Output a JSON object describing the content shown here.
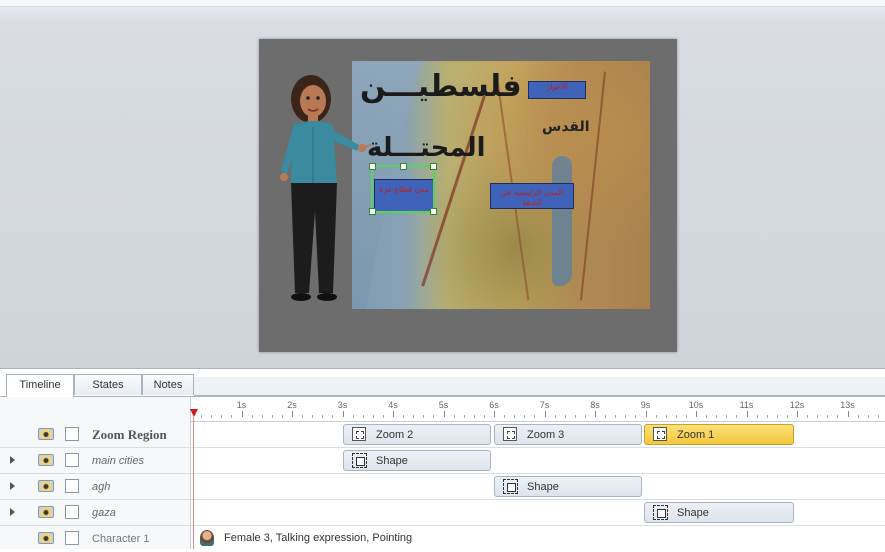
{
  "stage": {
    "map": {
      "title_line1": "فلسطيـــن",
      "title_line2": "المحتـــلة",
      "city_label": "القدس",
      "callout_top": "الاغوار",
      "callout_right": "المدن الرئيسية في الضفة",
      "callout_selected": "مدن قطاع غزة"
    }
  },
  "tabs": [
    {
      "label": "Timeline"
    },
    {
      "label": "States"
    },
    {
      "label": "Notes"
    }
  ],
  "ruler": {
    "ticks": [
      "1s",
      "2s",
      "3s",
      "4s",
      "5s",
      "6s",
      "7s",
      "8s",
      "9s",
      "10s",
      "11s",
      "12s",
      "13s"
    ]
  },
  "rows": [
    {
      "name": "Zoom Region"
    },
    {
      "name": "main cities"
    },
    {
      "name": "agh"
    },
    {
      "name": "gaza"
    },
    {
      "name": "Character 1"
    }
  ],
  "clips": {
    "zoom2": "Zoom 2",
    "zoom3": "Zoom 3",
    "zoom1": "Zoom 1",
    "shape_main_cities": "Shape",
    "shape_agh": "Shape",
    "shape_gaza": "Shape"
  },
  "character_track": {
    "description": "Female 3, Talking expression, Pointing"
  },
  "colors": {
    "selected_clip": "#f3c73b",
    "playhead": "#d21a1a",
    "selection_outline": "#5ad35a"
  }
}
